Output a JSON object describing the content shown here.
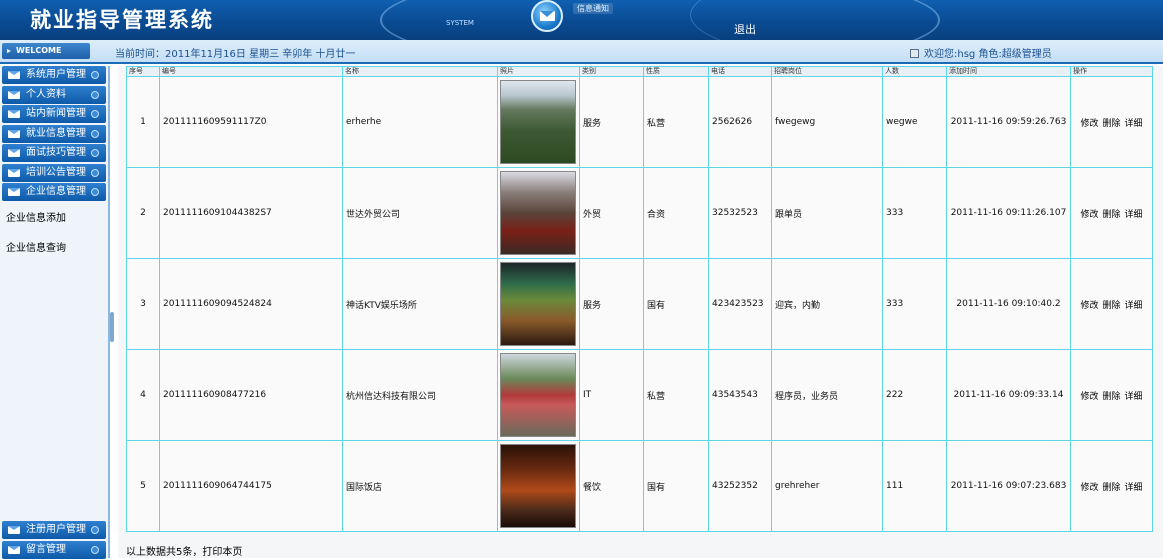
{
  "header": {
    "title": "就业指导管理系统",
    "system_label": "SYSTEM",
    "mail_label": "信息通知",
    "logout_label": "退出"
  },
  "info_bar": {
    "welcome_label": "WELCOME",
    "current_time": "当前时间：2011年11月16日 星期三 辛卯年 十月廿一",
    "user_info": "欢迎您:hsg 角色:超级管理员"
  },
  "sidebar": {
    "menu": [
      {
        "label": "系统用户管理"
      },
      {
        "label": "个人资料"
      },
      {
        "label": "站内新闻管理"
      },
      {
        "label": "就业信息管理"
      },
      {
        "label": "面试技巧管理"
      },
      {
        "label": "培训公告管理"
      },
      {
        "label": "企业信息管理"
      }
    ],
    "submenu": [
      {
        "label": "企业信息添加"
      },
      {
        "label": "企业信息查询"
      }
    ],
    "bottom_menu": [
      {
        "label": "注册用户管理"
      },
      {
        "label": "留言管理"
      }
    ]
  },
  "table": {
    "headers": [
      "序号",
      "编号",
      "名称",
      "照片",
      "类别",
      "性质",
      "电话",
      "招聘岗位",
      "人数",
      "添加时间",
      "操作"
    ],
    "rows": [
      {
        "idx": "1",
        "id": "2011111609591117Z0",
        "name": "erherhe",
        "type": "服务",
        "kind": "私营",
        "tel": "2562626",
        "position": "fwegewg",
        "count": "wegwe",
        "time": "2011-11-16 09:59:26.763"
      },
      {
        "idx": "2",
        "id": "20111116091044382S7",
        "name": "世达外贸公司",
        "type": "外贸",
        "kind": "合资",
        "tel": "32532523",
        "position": "跟单员",
        "count": "333",
        "time": "2011-11-16 09:11:26.107"
      },
      {
        "idx": "3",
        "id": "2011111609094524824",
        "name": "神话KTV娱乐场所",
        "type": "服务",
        "kind": "国有",
        "tel": "423423523",
        "position": "迎宾，内勤",
        "count": "333",
        "time": "2011-11-16 09:10:40.2"
      },
      {
        "idx": "4",
        "id": "201111160908477216",
        "name": "杭州信达科技有限公司",
        "type": "IT",
        "kind": "私营",
        "tel": "43543543",
        "position": "程序员，业务员",
        "count": "222",
        "time": "2011-11-16 09:09:33.14"
      },
      {
        "idx": "5",
        "id": "2011111609064744175",
        "name": "国际饭店",
        "type": "餐饮",
        "kind": "国有",
        "tel": "43252352",
        "position": "grehreher",
        "count": "111",
        "time": "2011-11-16 09:07:23.683"
      }
    ],
    "ops": {
      "edit": "修改",
      "delete": "删除",
      "detail": "详细"
    }
  },
  "footer": {
    "summary": "以上数据共5条，打印本页"
  }
}
